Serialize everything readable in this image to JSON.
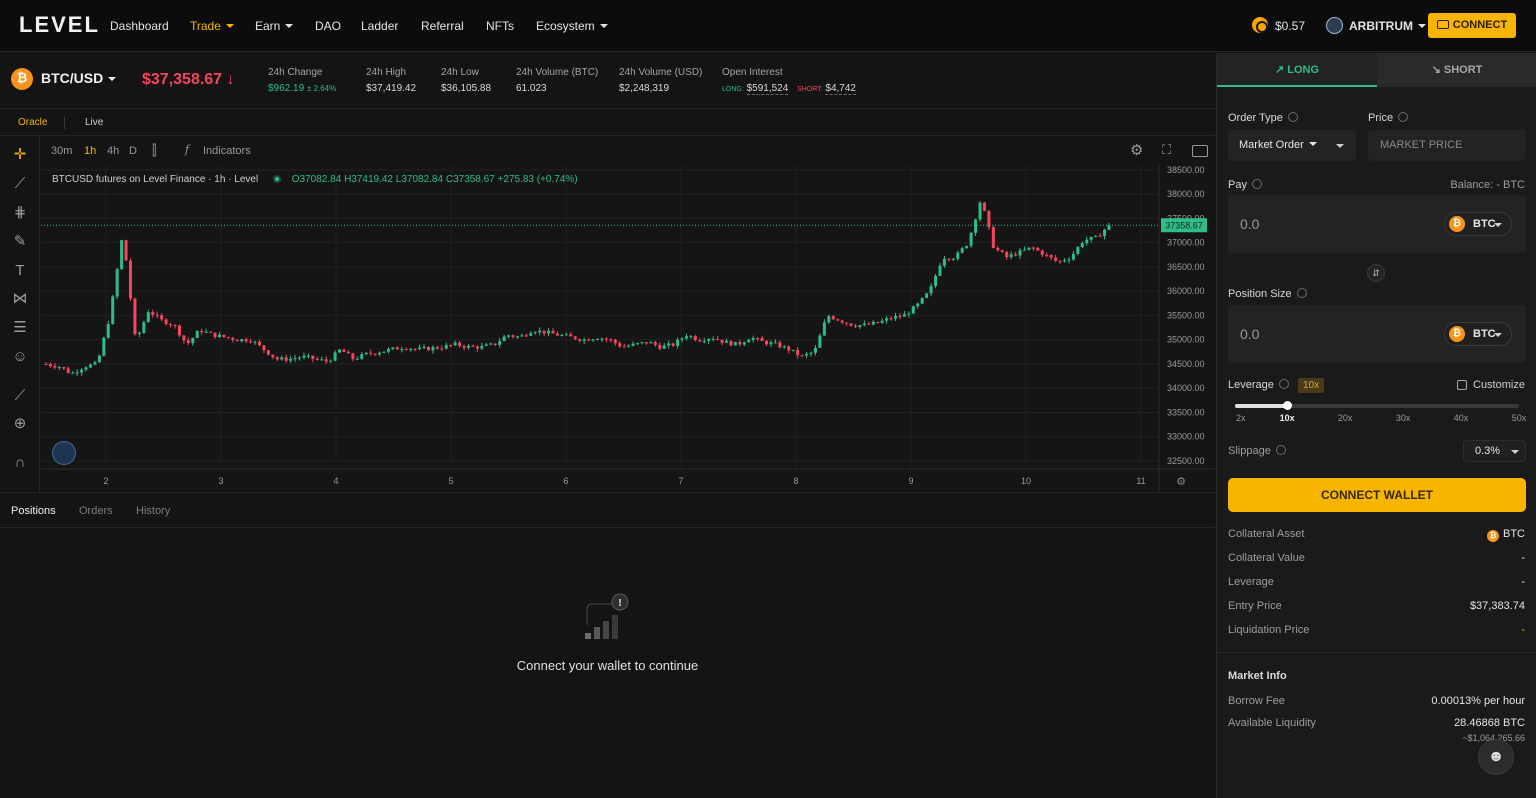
{
  "nav": {
    "logo": "LEVEL",
    "items": [
      "Dashboard",
      "Trade",
      "Earn",
      "DAO",
      "Ladder",
      "Referral",
      "NFTs",
      "Ecosystem"
    ],
    "token_price": "$0.57",
    "network": "ARBITRUM",
    "connect": "CONNECT"
  },
  "ticker": {
    "pair": "BTC/USD",
    "price": "$37,358.67",
    "stats": [
      {
        "label": "24h Change",
        "value": "$962.19",
        "extra": "2.64%"
      },
      {
        "label": "24h High",
        "value": "$37,419.42"
      },
      {
        "label": "24h Low",
        "value": "$36,105.88"
      },
      {
        "label": "24h Volume (BTC)",
        "value": "61.023"
      },
      {
        "label": "24h Volume (USD)",
        "value": "$2,248,319"
      },
      {
        "label": "Open Interest",
        "long_label": "LONG:",
        "long_value": "$591,524",
        "short_label": "SHORT:",
        "short_value": "$4,742"
      }
    ]
  },
  "source_tabs": [
    "Oracle",
    "Live"
  ],
  "chart_toolbar": {
    "intervals": [
      "30m",
      "1h",
      "4h",
      "D"
    ],
    "active_interval": "1h",
    "indicators": "Indicators"
  },
  "chart_data": {
    "type": "candlestick",
    "title": "BTCUSD futures on Level Finance · 1h · Level",
    "ohlc_label": {
      "o": "O37082.84",
      "h": "H37419.42",
      "l": "L37082.84",
      "c": "C37358.67",
      "change": "+275.83 (+0.74%)"
    },
    "last_price": "37358.67",
    "y_ticks": [
      "38500.00",
      "38000.00",
      "37500.00",
      "37000.00",
      "36500.00",
      "36000.00",
      "35500.00",
      "35000.00",
      "34500.00",
      "34000.00",
      "33500.00",
      "33000.00",
      "32500.00"
    ],
    "x_ticks": [
      "2",
      "3",
      "4",
      "5",
      "6",
      "7",
      "8",
      "9",
      "10",
      "11"
    ],
    "ylim": [
      32500,
      38600
    ],
    "path": [
      [
        0,
        34500
      ],
      [
        1,
        34450
      ],
      [
        2,
        34300
      ],
      [
        3,
        34450
      ],
      [
        4,
        34500
      ],
      [
        5,
        35500
      ],
      [
        6,
        37200
      ],
      [
        7,
        34950
      ],
      [
        8,
        35600
      ],
      [
        9,
        35400
      ],
      [
        10,
        35300
      ],
      [
        11,
        34900
      ],
      [
        12,
        35200
      ],
      [
        13,
        35100
      ],
      [
        14,
        35050
      ],
      [
        15,
        35000
      ],
      [
        16,
        35000
      ],
      [
        17,
        34800
      ],
      [
        18,
        34600
      ],
      [
        19,
        34600
      ],
      [
        20,
        34650
      ],
      [
        21,
        34600
      ],
      [
        22,
        34550
      ],
      [
        23,
        34800
      ],
      [
        24,
        34600
      ],
      [
        25,
        34700
      ],
      [
        26,
        34750
      ],
      [
        27,
        34800
      ],
      [
        28,
        34850
      ],
      [
        29,
        34800
      ],
      [
        30,
        34820
      ],
      [
        31,
        34850
      ],
      [
        32,
        34900
      ],
      [
        33,
        34850
      ],
      [
        34,
        34850
      ],
      [
        35,
        34900
      ],
      [
        36,
        35100
      ],
      [
        37,
        35050
      ],
      [
        38,
        35200
      ],
      [
        39,
        35150
      ],
      [
        40,
        35100
      ],
      [
        41,
        35050
      ],
      [
        42,
        35000
      ],
      [
        43,
        35050
      ],
      [
        44,
        35000
      ],
      [
        45,
        34850
      ],
      [
        46,
        34900
      ],
      [
        47,
        34950
      ],
      [
        48,
        34850
      ],
      [
        49,
        34900
      ],
      [
        50,
        35100
      ],
      [
        51,
        35000
      ],
      [
        52,
        35050
      ],
      [
        53,
        34950
      ],
      [
        54,
        34900
      ],
      [
        55,
        35050
      ],
      [
        56,
        34950
      ],
      [
        57,
        34900
      ],
      [
        58,
        34800
      ],
      [
        59,
        34650
      ],
      [
        60,
        34750
      ],
      [
        61,
        35500
      ],
      [
        62,
        35400
      ],
      [
        63,
        35300
      ],
      [
        64,
        35300
      ],
      [
        65,
        35350
      ],
      [
        66,
        35450
      ],
      [
        67,
        35500
      ],
      [
        68,
        35700
      ],
      [
        69,
        36000
      ],
      [
        70,
        36700
      ],
      [
        71,
        36700
      ],
      [
        72,
        37000
      ],
      [
        73,
        37900
      ],
      [
        74,
        36900
      ],
      [
        75,
        36700
      ],
      [
        76,
        36800
      ],
      [
        77,
        36900
      ],
      [
        78,
        36750
      ],
      [
        79,
        36600
      ],
      [
        80,
        36700
      ],
      [
        81,
        37050
      ],
      [
        82,
        37100
      ],
      [
        83,
        37358
      ]
    ]
  },
  "bottom_tabs": [
    "Positions",
    "Orders",
    "History"
  ],
  "empty_state": "Connect your wallet to continue",
  "panel": {
    "long": "LONG",
    "short": "SHORT",
    "order_type_label": "Order Type",
    "order_type": "Market Order",
    "price_label": "Price",
    "price_value": "MARKET PRICE",
    "pay_label": "Pay",
    "balance": "Balance: - BTC",
    "pay_amount": "0.0",
    "pay_token": "BTC",
    "position_label": "Position Size",
    "position_amount": "0.0",
    "position_token": "BTC",
    "leverage_label": "Leverage",
    "leverage_badge": "10x",
    "customize": "Customize",
    "leverage_ticks": [
      "2x",
      "10x",
      "20x",
      "30x",
      "40x",
      "50x"
    ],
    "leverage_value": 10,
    "slippage_label": "Slippage",
    "slippage_value": "0.3%",
    "connect_wallet": "CONNECT WALLET",
    "details": [
      {
        "label": "Collateral Asset",
        "value": "BTC"
      },
      {
        "label": "Collateral Value",
        "value": "-"
      },
      {
        "label": "Leverage",
        "value": "-"
      },
      {
        "label": "Entry Price",
        "value": "$37,383.74"
      },
      {
        "label": "Liquidation Price",
        "value": "-"
      }
    ],
    "market_info_title": "Market Info",
    "borrow_fee_label": "Borrow Fee",
    "borrow_fee": "0.00013% per hour",
    "liquidity_label": "Available Liquidity",
    "liquidity_btc": "28.46868 BTC",
    "liquidity_usd": "~$1,064,265.66"
  },
  "colors": {
    "accent": "#f7b500",
    "up": "#2fbd85",
    "down": "#f6465d",
    "bg": "#141414"
  }
}
